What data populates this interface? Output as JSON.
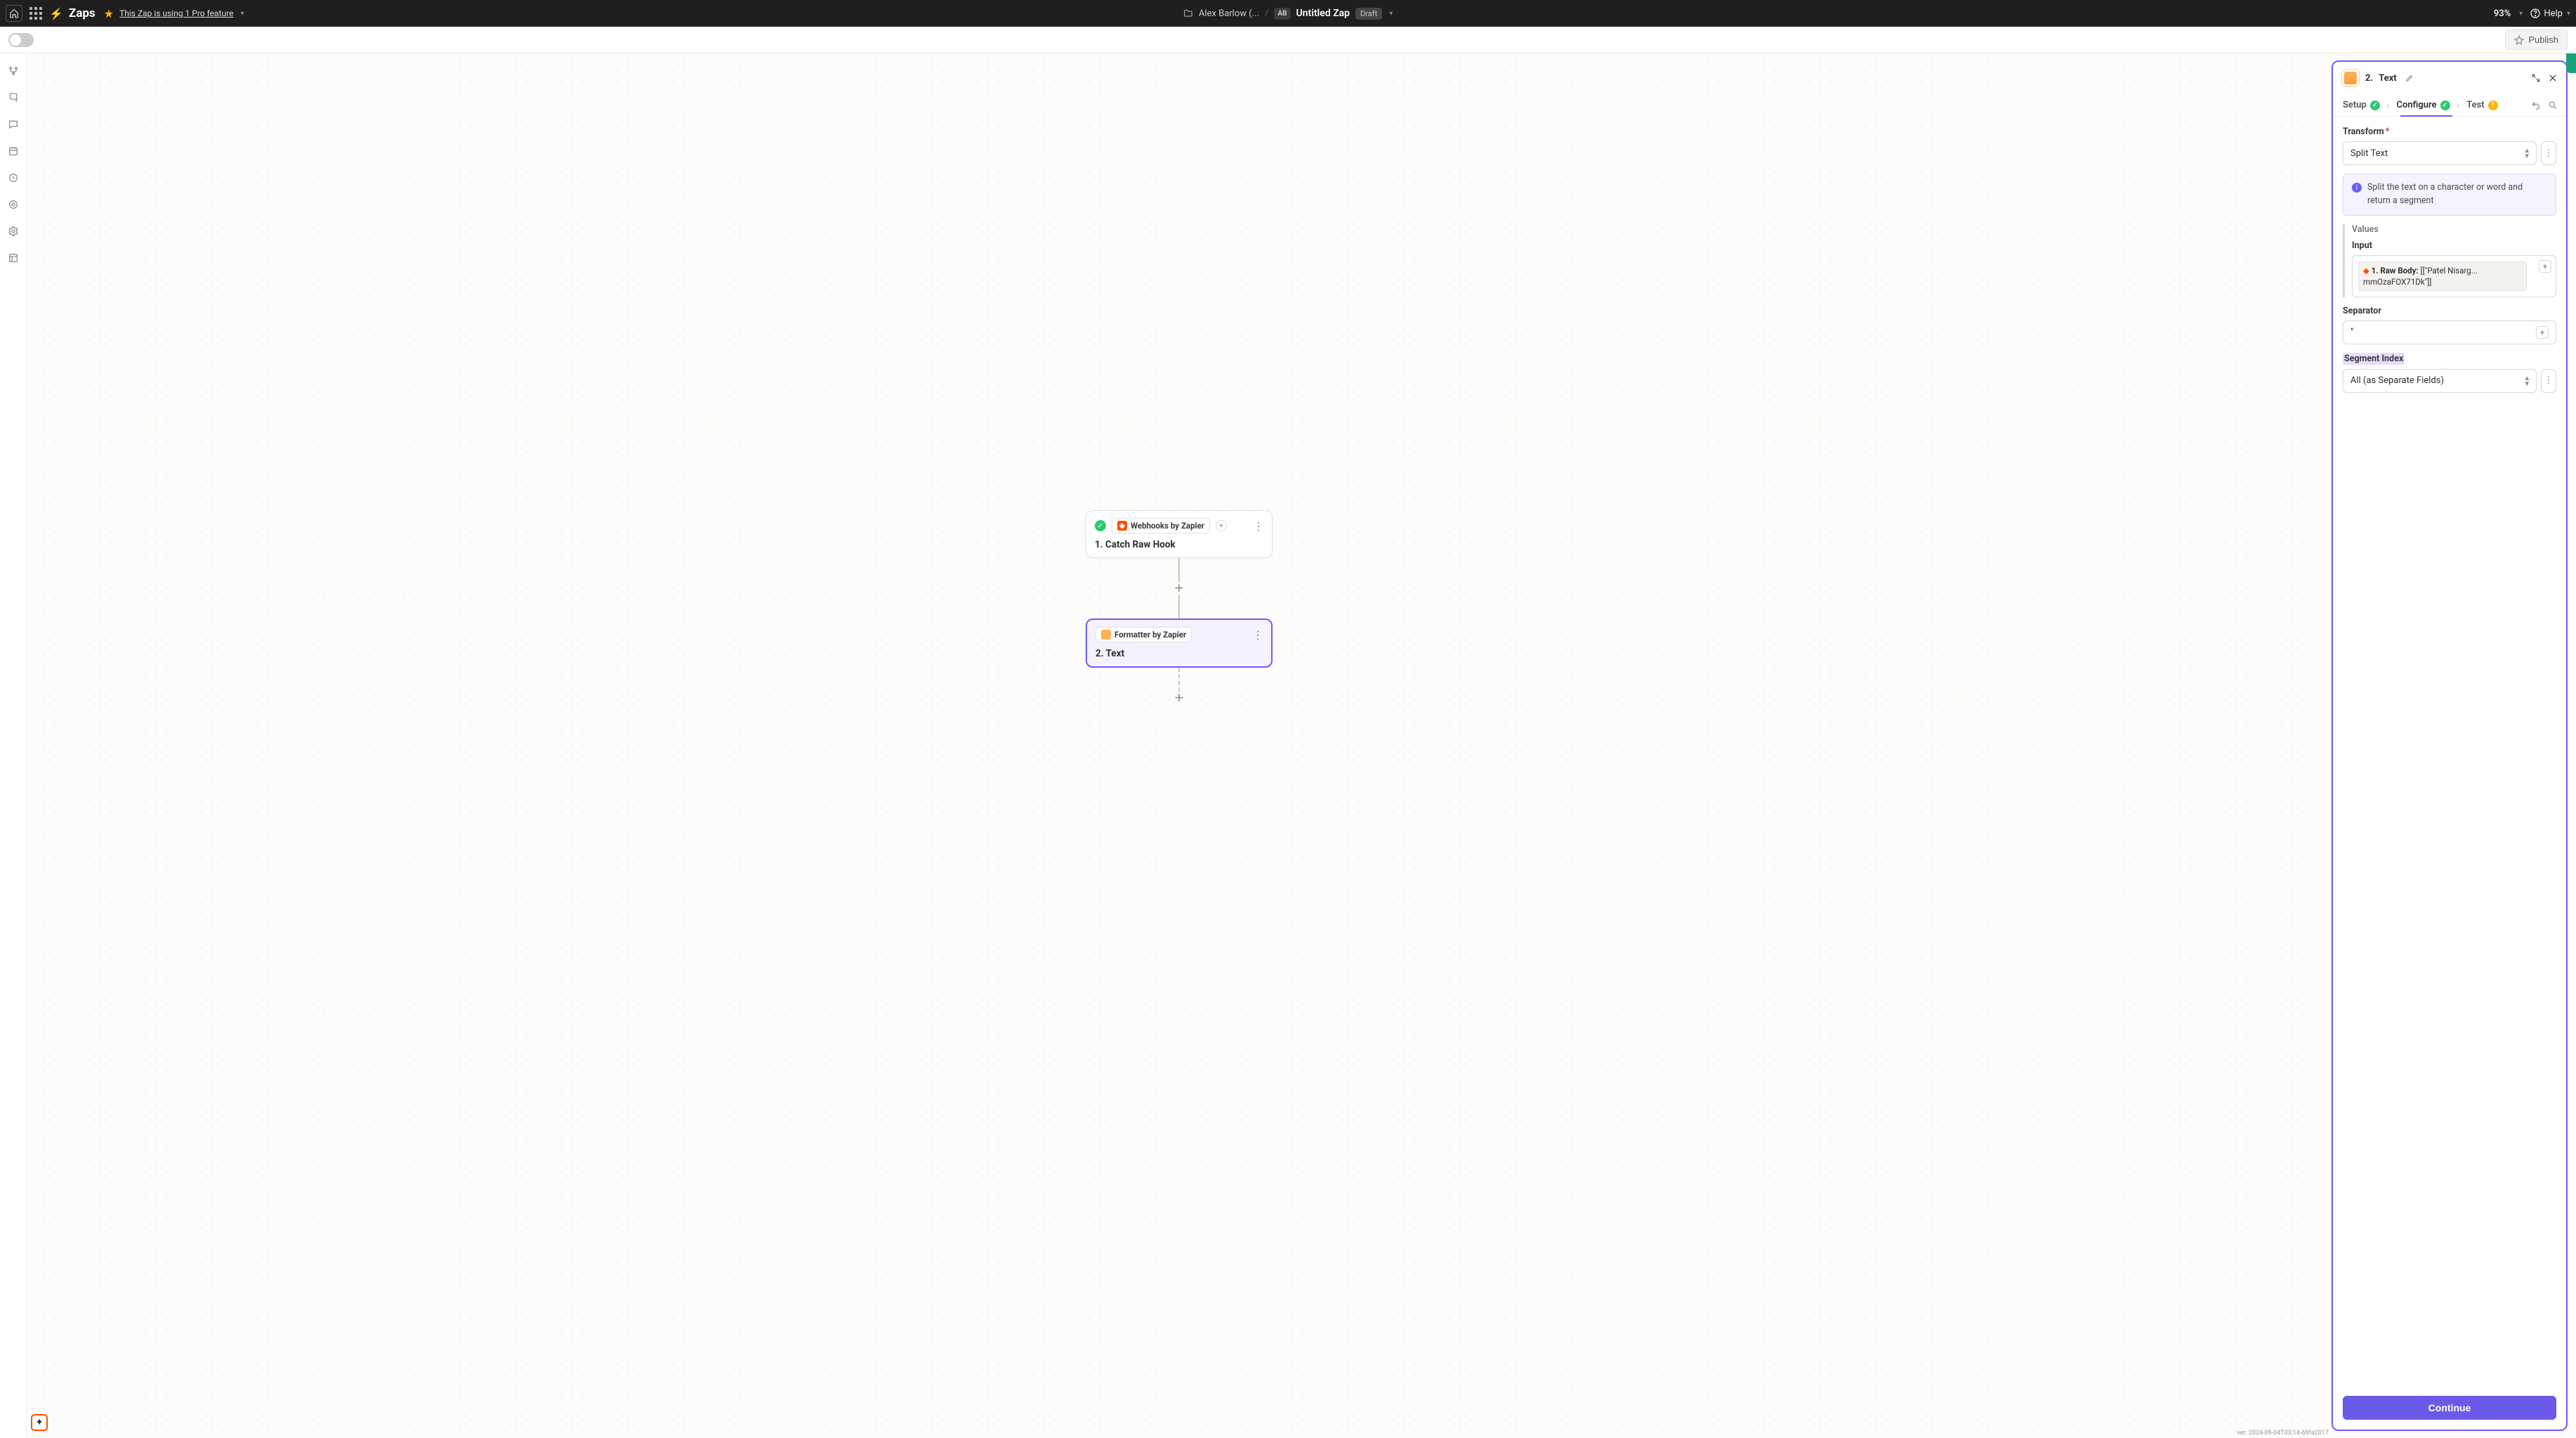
{
  "topbar": {
    "app_label": "Zaps",
    "pro_feature_link": "This Zap is using 1 Pro feature",
    "owner_name": "Alex Barlow (...",
    "avatar_initials": "AB",
    "zap_name": "Untitled Zap",
    "status_badge": "Draft",
    "zoom_level": "93%",
    "help_label": "Help"
  },
  "secbar": {
    "publish_label": "Publish"
  },
  "canvas": {
    "step1": {
      "app_chip": "Webhooks by Zapier",
      "title": "1. Catch Raw Hook"
    },
    "step2": {
      "app_chip": "Formatter by Zapier",
      "title": "2. Text"
    },
    "version_text": "ver. 2024-09-04T03:14-69fa2017"
  },
  "panel": {
    "header_num": "2.",
    "header_title": "Text",
    "tabs": {
      "setup": "Setup",
      "configure": "Configure",
      "test": "Test"
    },
    "transform": {
      "label": "Transform",
      "value": "Split Text",
      "info": "Split the text on a character or word and return a segment"
    },
    "values": {
      "group_label": "Values",
      "input_label": "Input",
      "pill_label": "1. Raw Body:",
      "pill_value": "[[\"Patel Nisarg... mmOzaFOX71Dk\"]]"
    },
    "separator": {
      "label": "Separator",
      "value": "\""
    },
    "segment_index": {
      "label": "Segment Index",
      "value": "All (as Separate Fields)"
    },
    "continue_label": "Continue"
  }
}
